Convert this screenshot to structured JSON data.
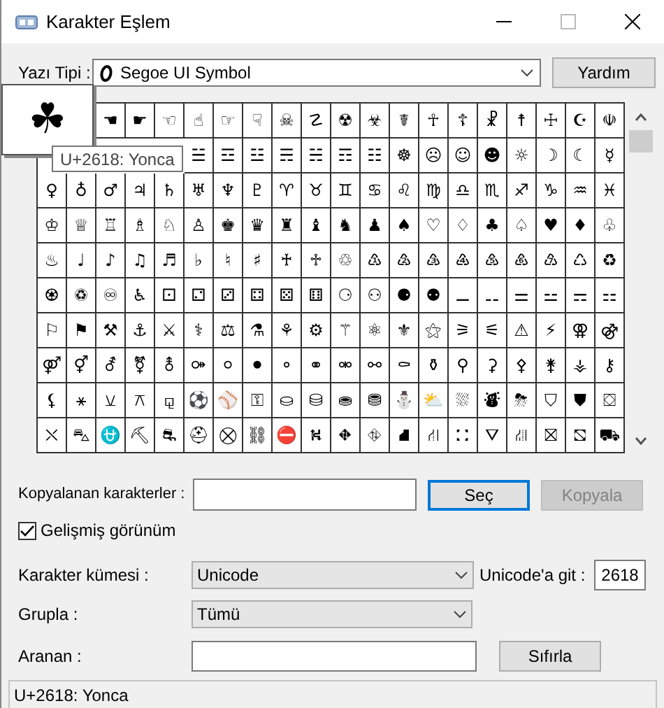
{
  "window": {
    "title": "Karakter Eşlem"
  },
  "font": {
    "label": "Yazı Tipi :",
    "value": "Segoe UI Symbol"
  },
  "help_button": "Yardım",
  "grid": {
    "rows": [
      [
        "",
        "",
        "☚",
        "☛",
        "☜",
        "☝",
        "☞",
        "☟",
        "☠",
        "☡",
        "☢",
        "☣",
        "☤",
        "☥",
        "☦",
        "☧",
        "☨",
        "☩",
        "☪",
        "☫"
      ],
      [
        "",
        "",
        "",
        "",
        "",
        "☱",
        "☲",
        "☳",
        "☴",
        "☵",
        "☶",
        "☷",
        "☸",
        "☹",
        "☺",
        "☻",
        "☼",
        "☽",
        "☾",
        "☿"
      ],
      [
        "♀",
        "♁",
        "♂",
        "♃",
        "♄",
        "♅",
        "♆",
        "♇",
        "♈",
        "♉",
        "♊",
        "♋",
        "♌",
        "♍",
        "♎",
        "♏",
        "♐",
        "♑",
        "♒",
        "♓"
      ],
      [
        "♔",
        "♕",
        "♖",
        "♗",
        "♘",
        "♙",
        "♚",
        "♛",
        "♜",
        "♝",
        "♞",
        "♟",
        "♠",
        "♡",
        "♢",
        "♣",
        "♤",
        "♥",
        "♦",
        "♧"
      ],
      [
        "♨",
        "♩",
        "♪",
        "♫",
        "♬",
        "♭",
        "♮",
        "♯",
        "♰",
        "♱",
        "♲",
        "♳",
        "♴",
        "♵",
        "♶",
        "♷",
        "♸",
        "♹",
        "♺",
        "♻"
      ],
      [
        "♼",
        "♽",
        "♾",
        "♿",
        "⚀",
        "⚁",
        "⚂",
        "⚃",
        "⚄",
        "⚅",
        "⚆",
        "⚇",
        "⚈",
        "⚉",
        "⚊",
        "⚋",
        "⚌",
        "⚍",
        "⚎",
        "⚏"
      ],
      [
        "⚐",
        "⚑",
        "⚒",
        "⚓",
        "⚔",
        "⚕",
        "⚖",
        "⚗",
        "⚘",
        "⚙",
        "⚚",
        "⚛",
        "⚜",
        "⚝",
        "⚞",
        "⚟",
        "⚠",
        "⚡",
        "⚢",
        "⚣"
      ],
      [
        "⚤",
        "⚥",
        "⚦",
        "⚧",
        "⚨",
        "⚩",
        "⚪",
        "⚫",
        "⚬",
        "⚭",
        "⚮",
        "⚯",
        "⚰",
        "⚱",
        "⚲",
        "⚳",
        "⚴",
        "⚵",
        "⚶",
        "⚷"
      ],
      [
        "⚸",
        "⚹",
        "⚺",
        "⚻",
        "⚼",
        "⚽",
        "⚾",
        "⚿",
        "⛀",
        "⛁",
        "⛂",
        "⛃",
        "⛄",
        "⛅",
        "⛆",
        "⛇",
        "⛈",
        "⛉",
        "⛊",
        "⛋"
      ],
      [
        "⛌",
        "⛍",
        "⛎",
        "⛏",
        "⛐",
        "⛑",
        "⛒",
        "⛓",
        "⛔",
        "⛕",
        "⛖",
        "⛗",
        "⛘",
        "⛙",
        "⛚",
        "⛛",
        "⛜",
        "⛝",
        "⛞",
        "⛟"
      ]
    ]
  },
  "magnified": {
    "glyph": "☘"
  },
  "tooltip": "U+2618: Yonca",
  "copy_row": {
    "label": "Kopyalanan karakterler :",
    "select_button": "Seç",
    "copy_button": {
      "label": "Kopyala",
      "disabled": true
    }
  },
  "advanced_view": {
    "label": "Gelişmiş görünüm",
    "checked": true
  },
  "charset": {
    "label": "Karakter kümesi :",
    "value": "Unicode"
  },
  "goto_unicode": {
    "label": "Unicode'a git :",
    "value": "2618"
  },
  "group_by": {
    "label": "Grupla :",
    "value": "Tümü"
  },
  "search": {
    "label": "Aranan :",
    "reset_button": "Sıfırla"
  },
  "status_bar": "U+2618: Yonca"
}
